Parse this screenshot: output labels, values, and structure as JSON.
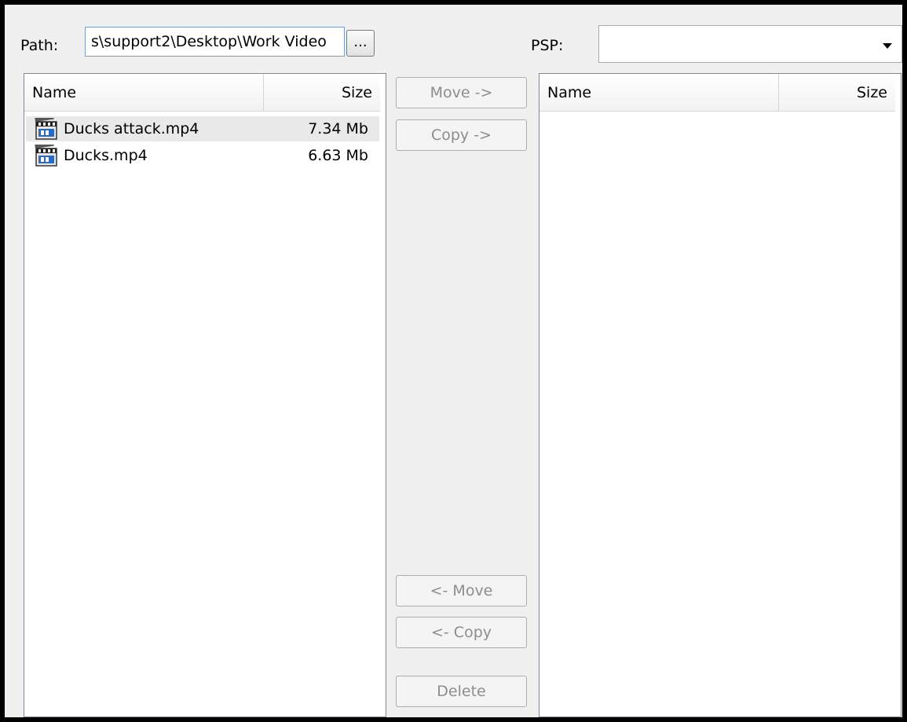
{
  "path": {
    "label": "Path:",
    "value": "s\\support2\\Desktop\\Work Video",
    "browse_label": "..."
  },
  "psp": {
    "label": "PSP:",
    "selected": ""
  },
  "left_list": {
    "columns": {
      "name": "Name",
      "size": "Size"
    },
    "rows": [
      {
        "name": "Ducks attack.mp4",
        "size": "7.34 Mb",
        "icon": "video-file-icon",
        "selected": true
      },
      {
        "name": "Ducks.mp4",
        "size": "6.63 Mb",
        "icon": "video-file-icon",
        "selected": false
      }
    ]
  },
  "right_list": {
    "columns": {
      "name": "Name",
      "size": "Size"
    },
    "rows": []
  },
  "buttons": {
    "move_right": "Move ->",
    "copy_right": "Copy ->",
    "move_left": "<- Move",
    "copy_left": "<- Copy",
    "delete": "Delete"
  }
}
